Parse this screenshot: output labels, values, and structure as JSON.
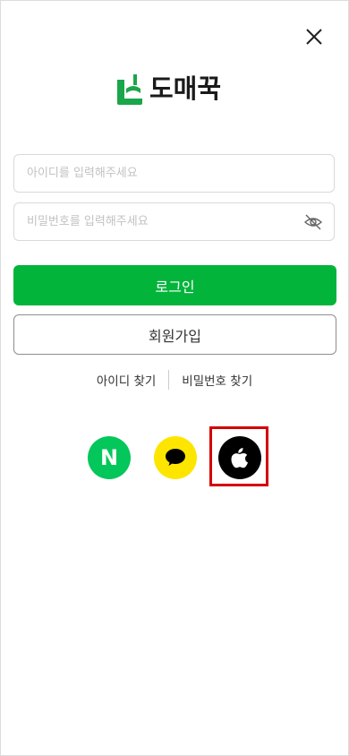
{
  "header": {
    "close_icon": "close-icon"
  },
  "logo": {
    "text": "도매꾹",
    "mark_icon": "domeggook-logo-mark",
    "brand_color": "#1aa64a"
  },
  "form": {
    "id_placeholder": "아이디를 입력해주세요",
    "id_value": "",
    "pw_placeholder": "비밀번호를 입력해주세요",
    "pw_value": "",
    "pw_toggle_icon": "eye-off-icon"
  },
  "buttons": {
    "login_label": "로그인",
    "login_color": "#03b43b",
    "signup_label": "회원가입"
  },
  "links": {
    "find_id": "아이디 찾기",
    "find_pw": "비밀번호 찾기"
  },
  "social": {
    "naver_label": "N",
    "naver_color": "#03c75a",
    "kakao_color": "#fee500",
    "apple_color": "#000000",
    "highlight_color": "#d40000"
  }
}
